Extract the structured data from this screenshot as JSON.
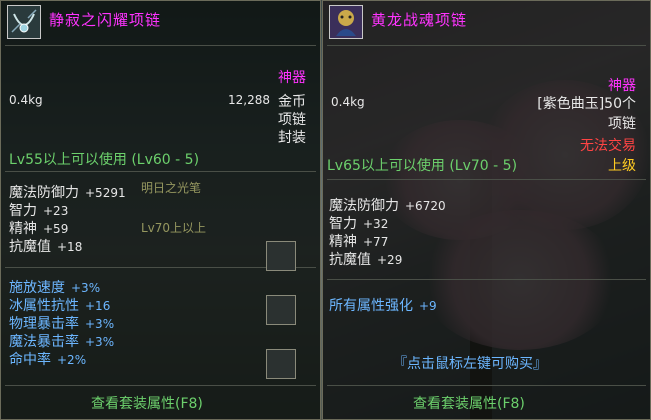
{
  "left": {
    "title": "静寂之闪耀项链",
    "rarity": "神器",
    "weight": "0.4kg",
    "price": "12,288",
    "price_unit": "金币",
    "type": "项链",
    "seal": "封装",
    "level_req": "Lv55以上可以使用 (Lv60 - 5)",
    "stats": [
      {
        "label": "魔法防御力",
        "value": "+5291"
      },
      {
        "label": "智力",
        "value": "+23"
      },
      {
        "label": "精神",
        "value": "+59"
      },
      {
        "label": "抗魔值",
        "value": "+18"
      }
    ],
    "bonus": [
      {
        "label": "施放速度",
        "value": "+3%"
      },
      {
        "label": "冰属性抗性",
        "value": "+16"
      },
      {
        "label": "物理暴击率",
        "value": "+3%"
      },
      {
        "label": "魔法暴击率",
        "value": "+3%"
      },
      {
        "label": "命中率",
        "value": "+2%"
      }
    ],
    "set_button": "查看套装属性(F8)",
    "background_text_1": "明日之光笔",
    "background_text_2": "Lv70上以上"
  },
  "right": {
    "title": "黄龙战魂项链",
    "rarity": "神器",
    "weight": "0.4kg",
    "price": "[紫色曲玉]50个",
    "type": "项链",
    "trade": "无法交易",
    "grade": "上级",
    "level_req": "Lv65以上可以使用 (Lv70 - 5)",
    "stats": [
      {
        "label": "魔法防御力",
        "value": "+6720"
      },
      {
        "label": "智力",
        "value": "+32"
      },
      {
        "label": "精神",
        "value": "+77"
      },
      {
        "label": "抗魔值",
        "value": "+29"
      }
    ],
    "bonus": [
      {
        "label": "所有属性强化",
        "value": "+9"
      }
    ],
    "buy_hint": "『点击鼠标左键可购买』",
    "set_button": "查看套装属性(F8)"
  },
  "colors": {
    "title": "#ff33ff",
    "level": "#6cd06c",
    "bonus": "#6cb6ff",
    "untradeable": "#ff4444",
    "grade": "#ffcc22"
  }
}
